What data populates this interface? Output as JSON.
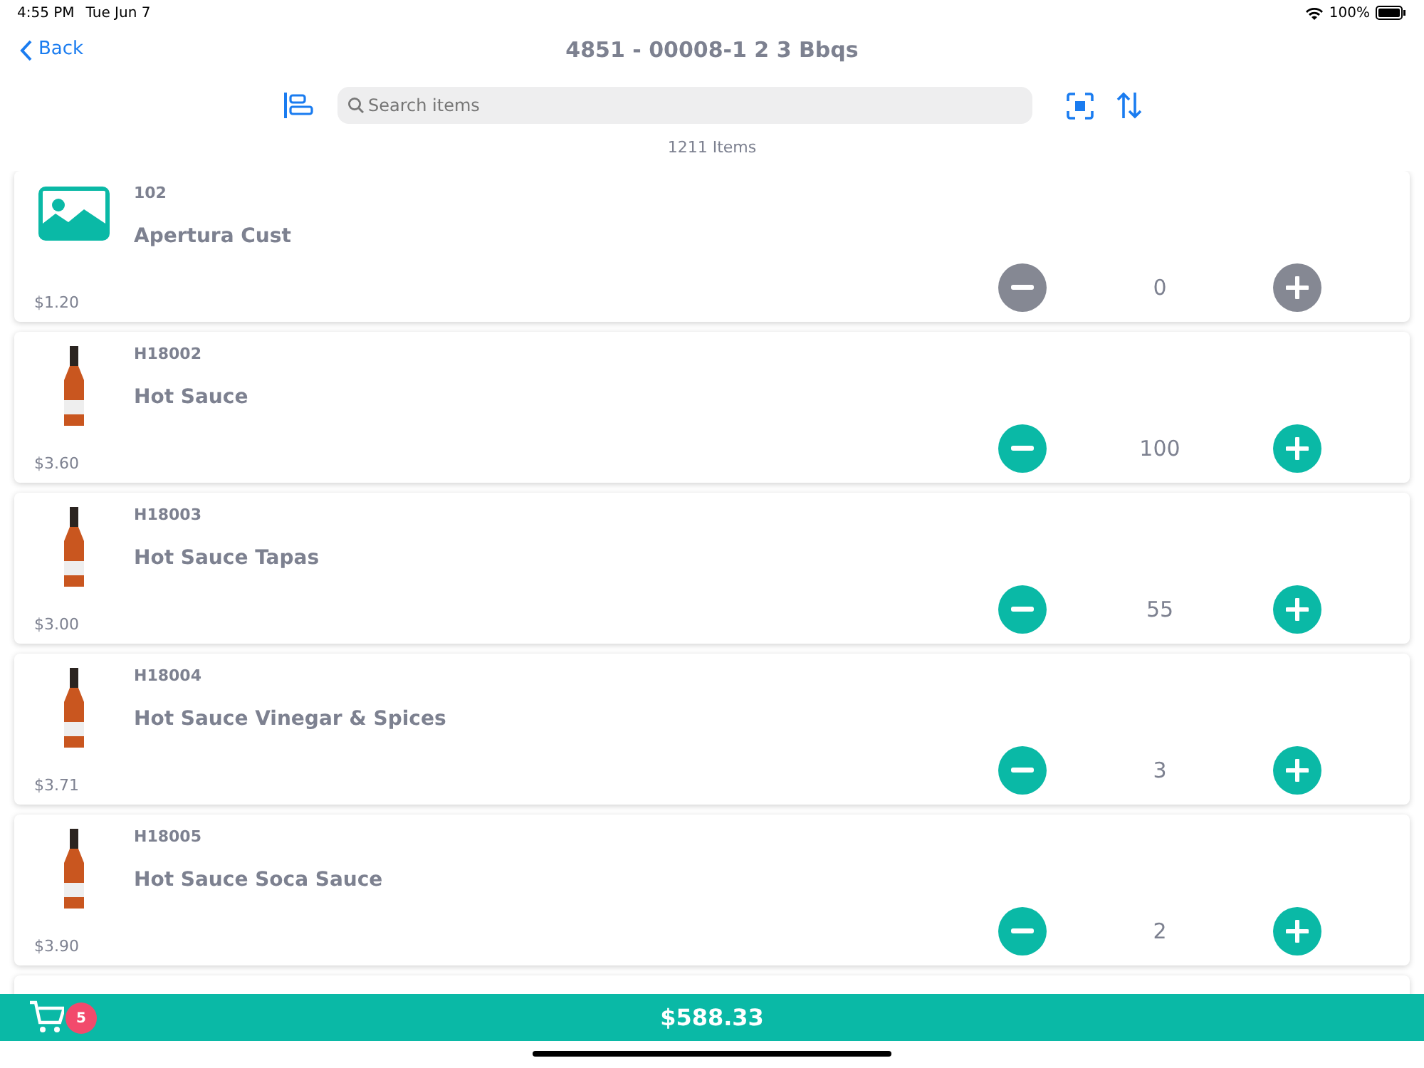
{
  "status_bar": {
    "time": "4:55 PM",
    "date": "Tue Jun 7",
    "battery": "100%"
  },
  "nav": {
    "back": "Back",
    "title": "4851 - 00008-1 2 3 Bbqs"
  },
  "search": {
    "placeholder": "Search items"
  },
  "item_count": "1211 Items",
  "items": [
    {
      "code": "102",
      "name": "Apertura Cust",
      "price": "$1.20",
      "quantity": "0",
      "kind": "placeholder",
      "in_cart": false
    },
    {
      "code": "H18002",
      "name": "Hot Sauce",
      "price": "$3.60",
      "quantity": "100",
      "kind": "photo",
      "in_cart": true
    },
    {
      "code": "H18003",
      "name": "Hot Sauce Tapas",
      "price": "$3.00",
      "quantity": "55",
      "kind": "photo",
      "in_cart": true
    },
    {
      "code": "H18004",
      "name": "Hot Sauce Vinegar & Spices",
      "price": "$3.71",
      "quantity": "3",
      "kind": "photo",
      "in_cart": true
    },
    {
      "code": "H18005",
      "name": "Hot Sauce Soca Sauce",
      "price": "$3.90",
      "quantity": "2",
      "kind": "photo",
      "in_cart": true
    }
  ],
  "cart": {
    "badge": "5",
    "total": "$588.33"
  }
}
